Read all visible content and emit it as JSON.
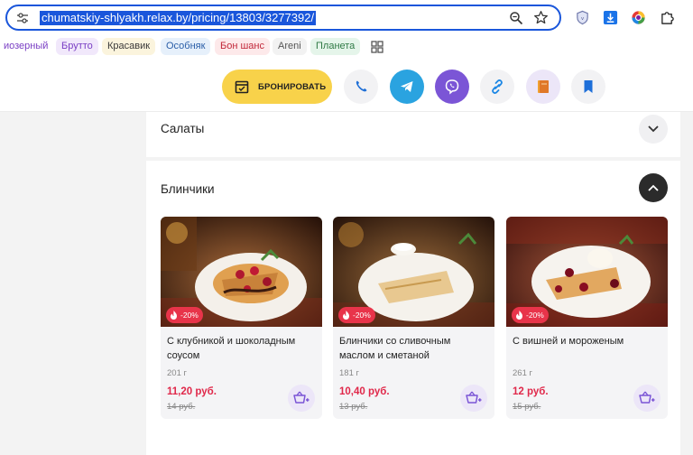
{
  "browser": {
    "url": "chumatskiy-shlyakh.relax.by/pricing/13803/3277392/",
    "bookmarks": [
      {
        "label": "иозерный",
        "bg": "#ffffff",
        "color": "#7a3fc4"
      },
      {
        "label": "Брутто",
        "bg": "#f1e8fb",
        "color": "#7a3fc4"
      },
      {
        "label": "Красавик",
        "bg": "#fbf4dd",
        "color": "#3a3a3a"
      },
      {
        "label": "Особняк",
        "bg": "#e6f0fb",
        "color": "#2a5ea8"
      },
      {
        "label": "Бон шанс",
        "bg": "#fde9ea",
        "color": "#c2283a"
      },
      {
        "label": "Areni",
        "bg": "#f2f2f2",
        "color": "#555555"
      },
      {
        "label": "Планета",
        "bg": "#e5f5ea",
        "color": "#2f7a45"
      }
    ]
  },
  "topbar": {
    "book_label": "БРОНИРОВАТЬ",
    "accent": "#f8d24a"
  },
  "sections": {
    "salads": {
      "title": "Салаты",
      "expanded": false
    },
    "pancakes": {
      "title": "Блинчики",
      "expanded": true
    }
  },
  "cards": [
    {
      "name": "С клубникой и шоколадным соусом",
      "weight": "201 г",
      "price": "11,20 руб.",
      "old_price": "14 руб.",
      "discount": "-20%"
    },
    {
      "name": "Блинчики со сливочным маслом и сметаной",
      "weight": "181 г",
      "price": "10,40 руб.",
      "old_price": "13 руб.",
      "discount": "-20%"
    },
    {
      "name": "С вишней и мороженым",
      "weight": "261 г",
      "price": "12 руб.",
      "old_price": "15 руб.",
      "discount": "-20%"
    }
  ],
  "colors": {
    "price": "#e0284a",
    "badge": "#e8344a",
    "telegram": "#2aa3e0",
    "viber": "#7b55d6"
  }
}
